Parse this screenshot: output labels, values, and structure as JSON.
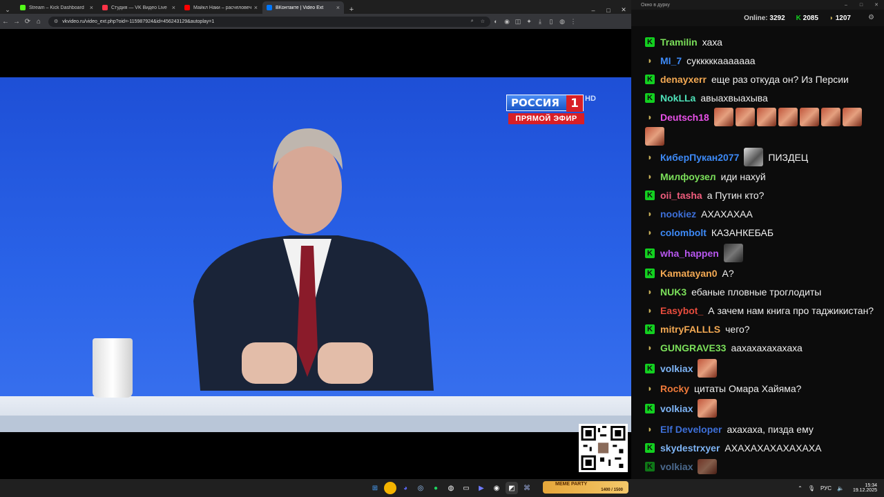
{
  "browser": {
    "tabs": [
      {
        "title": "Stream – Kick Dashboard",
        "color": "#53fc18"
      },
      {
        "title": "Студия — VK Видео Live",
        "color": "#ff3347"
      },
      {
        "title": "Майкл Наки – расчеловечива...",
        "color": "#ff0000"
      },
      {
        "title": "ВКонтакте | Video Ext",
        "color": "#0077ff",
        "active": true
      }
    ],
    "new_tab": "+",
    "url": "vkvideo.ru/video_ext.php?oid=-115987924&id=456243129&autoplay=1"
  },
  "video": {
    "channel_name": "РОССИЯ",
    "channel_number": "1",
    "hd_label": "HD",
    "live_label": "ПРЯМОЙ ЭФИР"
  },
  "chat": {
    "window_title": "Окно в дурку",
    "online_label": "Online:",
    "online_count": "3292",
    "kick_count": "2085",
    "vk_count": "1207",
    "accent": "#53fc18",
    "messages": [
      {
        "user": "Tramilin",
        "text": "хаха",
        "badge": "kick",
        "color": "#7be05a"
      },
      {
        "user": "MI_7",
        "text": "сукккккааааааа",
        "badge": "coin",
        "color": "#3d8af7"
      },
      {
        "user": "denayxerr",
        "text": "еще раз откуда он? Из Персии",
        "badge": "kick",
        "color": "#f3a953"
      },
      {
        "user": "NokLLa",
        "text": "авыахвыахыва",
        "badge": "kick",
        "color": "#4ee2b9"
      },
      {
        "user": "Deutsch18",
        "text": "",
        "badge": "coin",
        "color": "#e851e8"
      },
      {
        "user": "КиберПукан2077",
        "text": "ПИЗДЕЦ",
        "badge": "coin",
        "color": "#3d8af7"
      },
      {
        "user": "Милфоузел",
        "text": "иди нахуй",
        "badge": "coin",
        "color": "#7be05a"
      },
      {
        "user": "oii_tasha",
        "text": "а Путин кто?",
        "badge": "kick",
        "color": "#f05d7d"
      },
      {
        "user": "nookiez",
        "text": "АХАХАХАА",
        "badge": "coin",
        "color": "#3d6fd8"
      },
      {
        "user": "colombolt",
        "text": "КАЗАНКЕБАБ",
        "badge": "coin",
        "color": "#3d8af7"
      },
      {
        "user": "wha_happen",
        "text": "",
        "badge": "kick",
        "color": "#b857f0"
      },
      {
        "user": "Kamatayan0",
        "text": "А?",
        "badge": "kick",
        "color": "#f3a953"
      },
      {
        "user": "NUK3",
        "text": "ебаные пловные троглодиты",
        "badge": "coin",
        "color": "#7be05a"
      },
      {
        "user": "Easybot_",
        "text": "А зачем нам книга про таджикистан?",
        "badge": "coin",
        "color": "#e84c3d"
      },
      {
        "user": "mitryFALLLS",
        "text": "чего?",
        "badge": "kick",
        "color": "#f3a953"
      },
      {
        "user": "GUNGRAVE33",
        "text": "аахахахахахаха",
        "badge": "coin",
        "color": "#7be05a"
      },
      {
        "user": "volkiax",
        "text": "",
        "badge": "kick",
        "color": "#7eb4f5"
      },
      {
        "user": "Rocky",
        "text": "цитаты Омара Хайяма?",
        "badge": "coin",
        "color": "#f07a3a"
      },
      {
        "user": "volkiax",
        "text": "",
        "badge": "kick",
        "color": "#7eb4f5"
      },
      {
        "user": "Elf Developer",
        "text": "ахахаха, пизда ему",
        "badge": "coin",
        "color": "#3d6fd8"
      },
      {
        "user": "skydestrxyer",
        "text": "АХАХАХАХАХАХАХА",
        "badge": "kick",
        "color": "#7eb4f5"
      },
      {
        "user": "volkiax",
        "text": "",
        "badge": "kick",
        "color": "#7eb4f5"
      }
    ]
  },
  "taskbar": {
    "meme_title": "MEME PARTY",
    "meme_progress": "1400 / 1500",
    "lang": "РУС",
    "time": "15:34",
    "date": "19.12.2025"
  }
}
